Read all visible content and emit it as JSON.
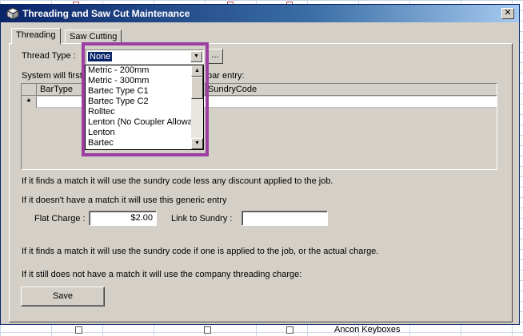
{
  "window": {
    "title": "Threading and Saw Cut Maintenance",
    "close_glyph": "✕"
  },
  "tabs": [
    {
      "label": "Threading",
      "active": true
    },
    {
      "label": "Saw Cutting",
      "active": false
    }
  ],
  "thread_type": {
    "label": "Thread Type :",
    "selected": "None",
    "ellipsis_label": "..."
  },
  "grid": {
    "intro_left": "System will first",
    "intro_right": "bar entry:",
    "columns": [
      "BarType",
      "SundryCode"
    ],
    "new_row_glyph": "*"
  },
  "dropdown": {
    "items": [
      "Metric - 200mm",
      "Metric - 300mm",
      "Bartec Type C1",
      "Bartec Type C2",
      "Rolltec",
      "Lenton (No Coupler Allowance)",
      "Lenton",
      "Bartec"
    ]
  },
  "texts": {
    "match_discount": "If it finds a match it will use the sundry code less any discount applied to the job.",
    "no_match_generic": "If it doesn't have a match it will use this generic entry",
    "match_actual": "If it finds a match it will use the sundry code if one is applied to the job, or the actual charge.",
    "still_no_match": "If it still does not have a match it will use the company threading charge:"
  },
  "flat_charge": {
    "label": "Flat Charge :",
    "value": "$2.00"
  },
  "link_sundry": {
    "label": "Link to Sundry :",
    "value": ""
  },
  "save_label": "Save",
  "background": {
    "cell_text": "Ancon Keyboxes"
  },
  "colors": {
    "highlight": "#9c3fa0",
    "titlebar": "#0a246a",
    "selection": "#0a246a"
  }
}
